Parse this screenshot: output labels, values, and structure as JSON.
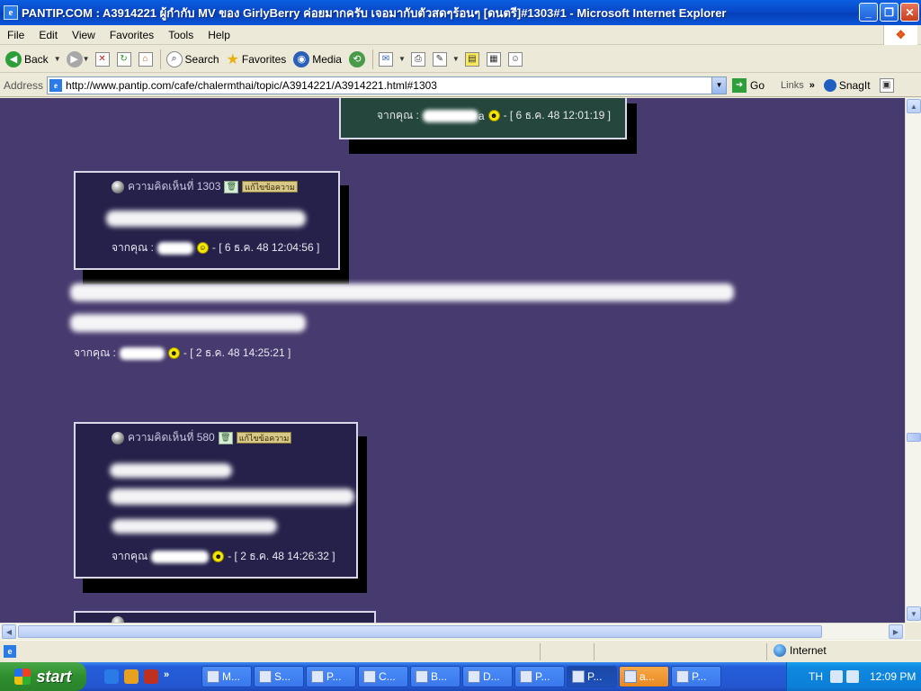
{
  "window": {
    "title": "PANTIP.COM : A3914221 ผู้กำกับ MV ของ GirlyBerry ค่อยมากครับ เจอมากับตัวสดๆร้อนๆ [ดนตรี]#1303#1 - Microsoft Internet Explorer",
    "app_icon_letter": "e",
    "minimize_symbol": "_",
    "restore_symbol": "❐",
    "close_symbol": "✕"
  },
  "menu": {
    "items": [
      "File",
      "Edit",
      "View",
      "Favorites",
      "Tools",
      "Help"
    ]
  },
  "toolbar": {
    "back_label": "Back",
    "search_label": "Search",
    "favorites_label": "Favorites",
    "media_label": "Media"
  },
  "address": {
    "label": "Address",
    "url": "http://www.pantip.com/cafe/chalermthai/topic/A3914221/A3914221.html#1303",
    "go_label": "Go",
    "links_label": "Links",
    "snagit_label": "SnagIt"
  },
  "comments": [
    {
      "from_prefix": "จากคุณ :",
      "name_suffix": "a",
      "timestamp": "- [ 6 ธ.ค. 48 12:01:19 ]"
    },
    {
      "header": "ความคิดเห็นที่ 1303",
      "edit_label": "แก้ไขข้อความ",
      "from_prefix": "จากคุณ :",
      "timestamp": "- [ 6 ธ.ค. 48 12:04:56 ]"
    },
    {
      "from_prefix": "จากคุณ :",
      "timestamp": "- [ 2 ธ.ค. 48 14:25:21 ]"
    },
    {
      "header": "ความคิดเห็นที่ 580",
      "edit_label": "แก้ไขข้อความ",
      "from_prefix": "จากคุณ",
      "timestamp": "- [ 2 ธ.ค. 48 14:26:32 ]"
    }
  ],
  "status": {
    "zone_label": "Internet"
  },
  "taskbar": {
    "start_label": "start",
    "tasks": [
      {
        "label": "M...",
        "active": false,
        "flash": false
      },
      {
        "label": "S...",
        "active": false,
        "flash": false
      },
      {
        "label": "P...",
        "active": false,
        "flash": false
      },
      {
        "label": "C...",
        "active": false,
        "flash": false
      },
      {
        "label": "B...",
        "active": false,
        "flash": false
      },
      {
        "label": "D...",
        "active": false,
        "flash": false
      },
      {
        "label": "P...",
        "active": false,
        "flash": false
      },
      {
        "label": "P...",
        "active": true,
        "flash": false
      },
      {
        "label": "a...",
        "active": false,
        "flash": true
      },
      {
        "label": "P...",
        "active": false,
        "flash": false
      }
    ],
    "lang": "TH",
    "clock": "12:09 PM"
  },
  "colors": {
    "page_bg": "#473a6e",
    "box_bg": "#25214a",
    "box_top_bg": "#24463c"
  }
}
